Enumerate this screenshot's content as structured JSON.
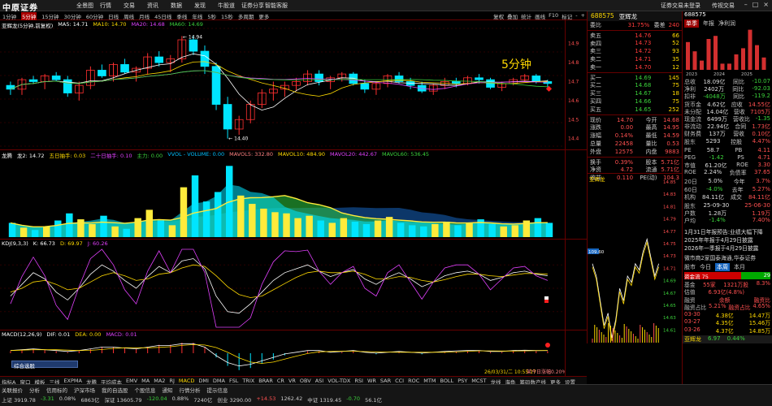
{
  "app": {
    "logo": "中原证券",
    "nav": [
      "全景图",
      "行情",
      "交易",
      "资讯",
      "数据",
      "发现",
      "牛股道",
      "证券分享",
      "智能客服"
    ],
    "login": "证券交易未登录",
    "broker_link": "传视交易"
  },
  "periods": [
    "1分钟",
    "5分钟",
    "15分钟",
    "30分钟",
    "60分钟",
    "日线",
    "周线",
    "月线",
    "45日线",
    "季线",
    "年线",
    "5秒",
    "15秒",
    "多周期",
    "更多"
  ],
  "period_tools": [
    "复权",
    "叠加",
    "统计",
    "画线",
    "F10",
    "标记",
    "-",
    "+"
  ],
  "main_chart": {
    "head": [
      "亚辉龙(5分钟,前复权)",
      "MA5: 14.71",
      "MA10: 14.70",
      "MA20: 14.68",
      "MA60: 14.69"
    ],
    "watermark": "5分钟",
    "high_label": "14.94",
    "low_label": "14.40",
    "price_labels": [
      "14.9",
      "14.8",
      "14.7",
      "14.6",
      "14.5",
      "14.4"
    ],
    "candles": [
      [
        14.68,
        14.7,
        14.63,
        14.66
      ],
      [
        14.66,
        14.72,
        14.63,
        14.71
      ],
      [
        14.71,
        14.73,
        14.69,
        14.7
      ],
      [
        14.7,
        14.74,
        14.66,
        14.73
      ],
      [
        14.73,
        14.75,
        14.7,
        14.71
      ],
      [
        14.71,
        14.73,
        14.62,
        14.64
      ],
      [
        14.64,
        14.7,
        14.6,
        14.68
      ],
      [
        14.68,
        14.78,
        14.66,
        14.76
      ],
      [
        14.76,
        14.79,
        14.72,
        14.73
      ],
      [
        14.73,
        14.8,
        14.7,
        14.79
      ],
      [
        14.79,
        14.82,
        14.74,
        14.75
      ],
      [
        14.75,
        14.78,
        14.7,
        14.77
      ],
      [
        14.77,
        14.85,
        14.74,
        14.83
      ],
      [
        14.83,
        14.86,
        14.78,
        14.8
      ],
      [
        14.8,
        14.84,
        14.75,
        14.82
      ],
      [
        14.82,
        14.94,
        14.8,
        14.92
      ],
      [
        14.92,
        14.94,
        14.84,
        14.86
      ],
      [
        14.86,
        14.89,
        14.74,
        14.78
      ],
      [
        14.78,
        14.8,
        14.55,
        14.58
      ],
      [
        14.58,
        14.62,
        14.4,
        14.45
      ],
      [
        14.45,
        14.52,
        14.42,
        14.5
      ],
      [
        14.5,
        14.6,
        14.48,
        14.58
      ],
      [
        14.58,
        14.66,
        14.56,
        14.64
      ],
      [
        14.64,
        14.7,
        14.6,
        14.66
      ],
      [
        14.66,
        14.7,
        14.62,
        14.68
      ],
      [
        14.68,
        14.72,
        14.65,
        14.7
      ],
      [
        14.7,
        14.76,
        14.68,
        14.74
      ],
      [
        14.74,
        14.76,
        14.68,
        14.7
      ],
      [
        14.7,
        14.73,
        14.66,
        14.72
      ],
      [
        14.72,
        14.75,
        14.7,
        14.74
      ],
      [
        14.74,
        14.75,
        14.68,
        14.69
      ],
      [
        14.69,
        14.71,
        14.64,
        14.66
      ],
      [
        14.66,
        14.7,
        14.63,
        14.69
      ],
      [
        14.69,
        14.74,
        14.67,
        14.73
      ],
      [
        14.73,
        14.75,
        14.69,
        14.7
      ],
      [
        14.7,
        14.72,
        14.66,
        14.68
      ],
      [
        14.68,
        14.7,
        14.64,
        14.65
      ],
      [
        14.65,
        14.69,
        14.63,
        14.68
      ],
      [
        14.68,
        14.72,
        14.66,
        14.7
      ],
      [
        14.7,
        14.72,
        14.67,
        14.69
      ],
      [
        14.69,
        14.73,
        14.68,
        14.72
      ],
      [
        14.72,
        14.74,
        14.69,
        14.71
      ],
      [
        14.71,
        14.72,
        14.66,
        14.67
      ],
      [
        14.67,
        14.7,
        14.65,
        14.69
      ],
      [
        14.69,
        14.72,
        14.68,
        14.71
      ],
      [
        14.71,
        14.74,
        14.7,
        14.73
      ],
      [
        14.73,
        14.74,
        14.69,
        14.7
      ],
      [
        14.7,
        14.71,
        14.67,
        14.69
      ]
    ]
  },
  "vol_chart": {
    "head": [
      "龙腾",
      "龙2: 14.72",
      "五日抽手: 0.03",
      "二十日抽手: 0.10",
      "主力: 0.00",
      "VVOL - VOLUME: 0.00",
      "MAVOL5: 332.80",
      "MAVOL10: 484.90",
      "MAVOL20: 442.67",
      "MAVOL60: 536.45"
    ],
    "volumes": [
      120,
      80,
      60,
      90,
      140,
      200,
      150,
      110,
      180,
      90,
      70,
      160,
      230,
      140,
      100,
      420,
      520,
      300,
      380,
      600,
      350,
      280,
      240,
      210,
      200,
      160,
      180,
      140,
      120,
      160,
      130,
      110,
      140,
      170,
      120,
      100,
      90,
      110,
      130,
      100,
      120,
      150,
      110,
      90,
      100,
      140,
      160,
      120
    ]
  },
  "kdj_chart": {
    "head": [
      "KDJ(9,3,3)",
      "K: 66.73",
      "D: 69.97",
      "J: 60.26"
    ],
    "k": [
      40,
      55,
      70,
      62,
      45,
      35,
      50,
      68,
      80,
      72,
      60,
      50,
      65,
      78,
      70,
      85,
      88,
      75,
      40,
      20,
      18,
      30,
      45,
      60,
      70,
      75,
      80,
      72,
      65,
      70,
      74,
      62,
      55,
      64,
      70,
      62,
      52,
      58,
      66,
      70,
      72,
      68,
      60,
      64,
      70,
      72,
      68,
      66
    ],
    "d": [
      45,
      50,
      58,
      60,
      55,
      48,
      50,
      58,
      66,
      70,
      66,
      60,
      62,
      68,
      70,
      76,
      80,
      78,
      66,
      52,
      42,
      38,
      40,
      48,
      56,
      64,
      70,
      72,
      70,
      70,
      72,
      68,
      62,
      62,
      65,
      64,
      60,
      58,
      61,
      65,
      68,
      68,
      66,
      65,
      67,
      69,
      69,
      68
    ],
    "j": [
      30,
      65,
      90,
      66,
      28,
      10,
      52,
      88,
      100,
      80,
      48,
      30,
      72,
      98,
      70,
      100,
      100,
      70,
      0,
      0,
      0,
      12,
      55,
      84,
      98,
      97,
      99,
      72,
      55,
      70,
      78,
      50,
      40,
      70,
      80,
      58,
      36,
      58,
      76,
      80,
      80,
      68,
      48,
      62,
      76,
      78,
      66,
      60
    ]
  },
  "macd_chart": {
    "head": [
      "MACD(12,26,9)",
      "DIF: 0.01",
      "DEA: 0.00",
      "MACD: 0.01"
    ],
    "hist": [
      0.01,
      0.015,
      0.02,
      0.015,
      0.01,
      0.005,
      0.01,
      0.02,
      0.03,
      0.03,
      0.025,
      0.02,
      0.03,
      0.04,
      0.04,
      0.05,
      0.05,
      0.03,
      -0.02,
      -0.06,
      -0.08,
      -0.07,
      -0.05,
      -0.03,
      -0.01,
      0.0,
      0.01,
      0.01,
      0.0,
      0.005,
      0.01,
      0.0,
      -0.005,
      0.0,
      0.005,
      0.0,
      -0.005,
      0.0,
      0.005,
      0.008,
      0.01,
      0.01,
      0.005,
      0.005,
      0.01,
      0.012,
      0.01,
      0.01
    ],
    "date_label": "26/03/31/二 10:55 17",
    "pct_label": "某今日涨幅0.20%"
  },
  "bottom_tabs": [
    "指标A",
    "窗口",
    "模板",
    "三线",
    "EXPMA",
    "龙腾",
    "平均成本",
    "EMV",
    "MA",
    "MA2",
    "RJ",
    "MACD",
    "DMI",
    "DMA",
    "FSL",
    "TRIX",
    "BRAR",
    "CR",
    "VR",
    "OBV",
    "ASI",
    "VOL-TDX",
    "RSI",
    "WR",
    "SAR",
    "CCI",
    "ROC",
    "MTM",
    "BOLL",
    "PSY",
    "MCST",
    "龙线",
    "海龟",
    "筹码数产线",
    "更多",
    "设置"
  ],
  "popup": "综合选股",
  "statusbar": {
    "row1": [
      "关联报价",
      "分析",
      "信用标的",
      "沪深市场",
      "我的自选股",
      "个股信息",
      "通知",
      "行情分析",
      "提示信息"
    ],
    "row2": [
      "上证 3919.78",
      "-3.31",
      "0.08%",
      "6863亿",
      "深证 13605.79",
      "-120.04",
      "0.88%",
      "7240亿",
      "创业 3290.00",
      "+14.53",
      "1262.42",
      "中证 1319.45",
      "-0.70",
      "56.1亿"
    ]
  },
  "orderbook": {
    "code": "688575",
    "name": "亚辉龙",
    "weibi_label": "委比",
    "weibi": "31.75%",
    "weicha_label": "委差",
    "weicha": "240",
    "asks": [
      [
        "卖五",
        "14.76",
        "66"
      ],
      [
        "卖四",
        "14.73",
        "52"
      ],
      [
        "卖三",
        "14.72",
        "93"
      ],
      [
        "卖二",
        "14.71",
        "35"
      ],
      [
        "卖一",
        "14.70",
        "12"
      ]
    ],
    "bids": [
      [
        "买一",
        "14.69",
        "145"
      ],
      [
        "买二",
        "14.68",
        "75"
      ],
      [
        "买三",
        "14.67",
        "18"
      ],
      [
        "买四",
        "14.66",
        "75"
      ],
      [
        "买五",
        "14.65",
        "252"
      ]
    ],
    "stats": [
      [
        "现价",
        "14.70",
        "今开",
        "14.68"
      ],
      [
        "涨跌",
        "0.00",
        "最高",
        "14.95"
      ],
      [
        "涨幅",
        "0.14%",
        "最低",
        "14.59"
      ],
      [
        "总量",
        "22458",
        "量比",
        "0.53"
      ],
      [
        "外盘",
        "12575",
        "内盘",
        "9883"
      ]
    ],
    "stats2": [
      [
        "换手",
        "0.39%",
        "股本",
        "5.71亿"
      ],
      [
        "净资",
        "4.72",
        "流通",
        "5.71亿"
      ],
      [
        "收益",
        "0.110",
        "PE(动)",
        "104.3"
      ]
    ]
  },
  "tick_chart": {
    "title": "亚辉龙",
    "prices": [
      14.85,
      14.84,
      14.83,
      14.82,
      14.81,
      14.8,
      14.79,
      14.78,
      14.77,
      14.76,
      14.75,
      14.74,
      14.73,
      14.72,
      14.71,
      14.7,
      14.69,
      14.68,
      14.67,
      14.66,
      14.65,
      14.64,
      14.63,
      14.62,
      14.61,
      14.6
    ],
    "highlight": "109.60"
  },
  "right_col": {
    "code": "688575",
    "tabs": [
      "单季",
      "年报",
      "净利润"
    ],
    "bar_years": [
      "2023",
      "2024",
      "2025"
    ],
    "bars": [
      9,
      6,
      3,
      10,
      11,
      2,
      2,
      5,
      7,
      13,
      8,
      4
    ],
    "fin_rows": [
      [
        "总收",
        "18.09亿",
        "同比",
        "-10.07"
      ],
      [
        "净利",
        "2402万",
        "同比",
        "-92.03"
      ],
      [
        "扣非",
        "-4048万",
        "同比",
        "-119.2"
      ],
      [
        "货币金",
        "4.62亿",
        "应收",
        "14.55亿"
      ],
      [
        "未分配",
        "14.04亿",
        "营收",
        "7105万"
      ],
      [
        "现金流",
        "6499万",
        "营收比",
        "-1.35"
      ],
      [
        "非流动",
        "22.94亿",
        "合同",
        "1.73亿"
      ],
      [
        "财务费",
        "137万",
        "营收",
        "0.10亿"
      ],
      [
        "股东",
        "5293",
        "控股",
        "4.47%"
      ]
    ],
    "valuation": [
      [
        "PE",
        "58.7",
        "PB",
        "4.11"
      ],
      [
        "PEG",
        "-1.42",
        "PS",
        "4.71"
      ],
      [
        "市值",
        "61.20亿",
        "ROE",
        "3.30"
      ],
      [
        "ROE",
        "2.24%",
        "负债率",
        "37.65"
      ]
    ],
    "perf": [
      [
        "20日",
        "5.0%",
        "今年",
        "3.7%"
      ],
      [
        "60日",
        "-4.0%",
        "去年",
        "5.27%"
      ],
      [
        "机构",
        "84.11亿",
        "成交",
        "84.11亿"
      ]
    ],
    "dates": [
      [
        "股东",
        "25-09-30",
        "",
        "25-06-30"
      ],
      [
        "户数",
        "1.28万",
        "",
        "1.19万"
      ],
      [
        "户均",
        "-1.4%",
        "",
        "7.40%"
      ]
    ],
    "notices": [
      "1月31日年报预告:业绩大幅下降",
      "2025年年报于4月29日披露",
      "2026年一季报于4月29日披露"
    ],
    "broker_note": "微市商2家国泰海通,华泰证券",
    "flow_tabs": [
      "股市",
      "今日",
      "本周",
      "本月"
    ],
    "flow_bar": [
      "资金流",
      "75",
      "29"
    ],
    "flow_rows": [
      [
        "基金",
        "55家",
        "1321万股",
        "8.3%"
      ],
      [
        "估值",
        "6.93亿(4.8%)",
        "",
        " "
      ],
      [
        "融资",
        "余额",
        "融资比"
      ],
      [
        "融资占比",
        "5.21%",
        "融资占比",
        "4.65%"
      ]
    ],
    "margin_rows": [
      [
        "03-30",
        "4.38亿",
        "14.47万"
      ],
      [
        "03-27",
        "4.35亿",
        "15.46万"
      ],
      [
        "03-26",
        "4.37亿",
        "14.85万"
      ]
    ],
    "bottom_quote": [
      "亚辉龙",
      "6.97",
      "0.44%"
    ]
  }
}
